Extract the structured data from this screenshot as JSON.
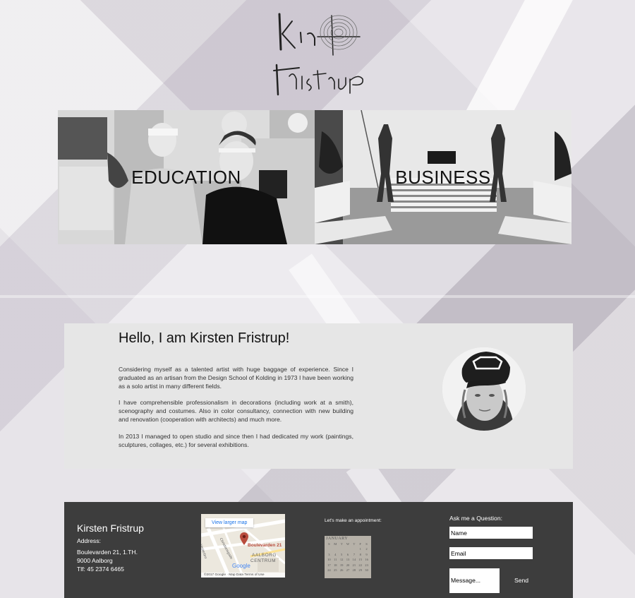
{
  "logo": {
    "text_line1": "Kir",
    "text_line2": "Fristrup"
  },
  "banner": {
    "tiles": [
      {
        "label": "EDUCATION"
      },
      {
        "label": "BUSINESS"
      }
    ]
  },
  "about": {
    "title": "Hello, I am Kirsten Fristrup!",
    "paragraphs": [
      "Considering myself as a talented artist with huge baggage of experience. Since I graduated as an artisan from the Design School of Kolding in 1973 I have been working as a solo artist in many different fields.",
      "I have comprehensible professionalism in decorations (including work at a smith), scenography and costumes. Also in color consultancy, connection with new building and renovation (cooperation with architects) and much more.",
      "In 2013 I managed to open studio and since then I had dedicated my work (paintings, sculptures, collages, etc.) for several exhibitions."
    ]
  },
  "footer": {
    "name": "Kirsten Fristrup",
    "address_label": "Address:",
    "street": "Boulevarden 21, 1.TH.",
    "city": "9000 Aalborg",
    "phone": "Tlf: 45 2374 6465",
    "map": {
      "link": "View larger map",
      "pin_label": "Boulevarden 21",
      "area_line1": "AALBORG",
      "area_line2": "CENTRUM",
      "street1": "Vesterbro",
      "street2": "Christiansgade",
      "google": "Google",
      "credits": "©2017 Google · Map Data  Terms of Use"
    },
    "appointment_label": "Let's make an appointment:",
    "calendar": {
      "month": "JANUARY",
      "weekdays": [
        "S",
        "M",
        "T",
        "W",
        "T",
        "F",
        "S"
      ],
      "days": [
        "",
        "",
        "",
        "",
        "",
        "1",
        "2",
        "3",
        "4",
        "5",
        "6",
        "7",
        "8",
        "9",
        "10",
        "11",
        "12",
        "13",
        "14",
        "15",
        "16",
        "17",
        "18",
        "19",
        "20",
        "21",
        "22",
        "23",
        "24",
        "25",
        "26",
        "27",
        "28",
        "29",
        "30"
      ]
    },
    "ask_label": "Ask me a Question:",
    "name_placeholder": "Name",
    "email_placeholder": "Email",
    "message_placeholder": "Message...",
    "send_label": "Send"
  },
  "colors": {
    "footer_bg": "#3d3d3d",
    "about_bg": "#e6e6e6"
  }
}
